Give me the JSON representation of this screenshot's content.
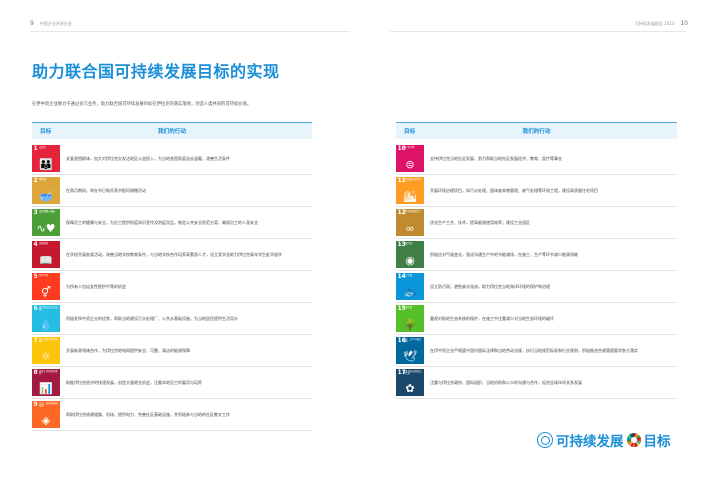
{
  "header": {
    "left_page_number": "9",
    "left_text": "中国企业共享社会",
    "right_text": "可持续发展报告 2023",
    "right_page_number": "10"
  },
  "title": "助力联合国可持续发展目标的实现",
  "intro": "在伊中资企业致力于通过多元业务，助力联合国可持续发展目标在伊拉克的落实落地，创造人类共同的可持续价值。",
  "table_headers": {
    "goal": "目标",
    "action": "我们的行动"
  },
  "left_goals": [
    {
      "num": "1",
      "label": "无贫穷",
      "icon": "family-icon",
      "glyph": "👪",
      "color": "#e5243b",
      "action": "关爱贫困群体，加大对伊拉克欠发达地区公益投入，为当地贫困家庭送去温暖，改善生活条件"
    },
    {
      "num": "2",
      "label": "零饥饿",
      "icon": "bowl-icon",
      "glyph": "🥣",
      "color": "#dda63a",
      "action": "在斋月期间，举办节日和开斋节慰问捐赠活动"
    },
    {
      "num": "3",
      "label": "良好健康与福祉",
      "icon": "heartbeat-icon",
      "glyph": "∿♥",
      "color": "#4c9f38",
      "action": "保障员工的健康与安全，为员工提供防疫知识宣传及防疫用品，制定公共安全防范方案，确保员工的人身安全"
    },
    {
      "num": "4",
      "label": "优质教育",
      "icon": "book-icon",
      "glyph": "📖",
      "color": "#c5192d",
      "action": "在学校开展各类活动，改善当地学校教育条件，与当地学校合作培养高素质人才，设立奖学金助力伊拉克青年学生赴华留学"
    },
    {
      "num": "5",
      "label": "性别平等",
      "icon": "gender-equality-icon",
      "glyph": "⚥",
      "color": "#ff3a21",
      "action": "为所有人包括女性提供平等的机会"
    },
    {
      "num": "6",
      "label": "清洁饮水和卫生设施",
      "icon": "water-icon",
      "glyph": "💧",
      "color": "#26bde2",
      "action": "积极发挥中资企业的优势，帮助当地建设污水处理厂、公共水基础设施，为当地居民提供生活用水"
    },
    {
      "num": "7",
      "label": "经济适用的清洁能源",
      "icon": "energy-icon",
      "glyph": "☼",
      "color": "#fcc30b",
      "action": "开展新源领域合作，为伊拉克地电网提供安全、可靠、清洁的能源保障"
    },
    {
      "num": "8",
      "label": "体面工作和经济增长",
      "icon": "growth-chart-icon",
      "glyph": "📊",
      "color": "#a21942",
      "action": "助推伊拉克经济的快速发展，创造大量就业机会，注重本地员工的雇用与培养"
    },
    {
      "num": "9",
      "label": "产业、创新和基础设施",
      "icon": "infrastructure-icon",
      "glyph": "◈",
      "color": "#fd6925",
      "action": "帮助伊拉克修建道路、机场、提供电力、完善社区基础设施，并积极参与当地的社区教文工作"
    }
  ],
  "right_goals": [
    {
      "num": "10",
      "label": "减少不平等",
      "icon": "reduced-inequality-icon",
      "glyph": "⊜",
      "color": "#dd1367",
      "action": "支持伊拉克当地社区发展，努力帮助当地社区发展经济、教育、医疗等事业"
    },
    {
      "num": "11",
      "label": "可持续城市和社区",
      "icon": "city-icon",
      "glyph": "🏙",
      "color": "#fd9d24",
      "action": "开展环境治理项目，如污水处理、固体废弃物管理、废气处理等环保工程，建设高质量住宅项目"
    },
    {
      "num": "12",
      "label": "负责任消费和生产",
      "icon": "infinity-icon",
      "glyph": "∞",
      "color": "#bf8b2e",
      "action": "优化生产工艺、技术，提高能源使用效率；建设工业园区"
    },
    {
      "num": "13",
      "label": "气候行动",
      "icon": "climate-eye-icon",
      "glyph": "◉",
      "color": "#3f7e44",
      "action": "积极应对气候变化，强化沟通生产中的节能减排，在施工、生产等环节减少能源消耗"
    },
    {
      "num": "14",
      "label": "水下生物",
      "icon": "fish-icon",
      "glyph": "🐟",
      "color": "#0a97d9",
      "action": "设立防污网，避免废水溢流，助力伊拉克当地海洋环境的保护和治理"
    },
    {
      "num": "15",
      "label": "陆地生物",
      "icon": "tree-icon",
      "glyph": "🌳",
      "color": "#56c02b",
      "action": "重视对陆地生态系统的保护，在施工中注重减少对当地生态环境的破坏"
    },
    {
      "num": "16",
      "label": "和平、正义与强大机构",
      "icon": "dove-icon",
      "glyph": "🕊",
      "color": "#00689d",
      "action": "在伊中资企业严格遵守国内国际法律和当地劳动法规，执行当地规范标准和行业规则，积极推进合规管理要求各方落实"
    },
    {
      "num": "17",
      "label": "促进目标实现的伙伴关系",
      "icon": "partnership-icon",
      "glyph": "✿",
      "color": "#19486a",
      "action": "注重与伊拉克政府、国际组织、当地机构和公众的沟通与合作，促进全球伙伴关系发展"
    }
  ],
  "logo": {
    "text": "可持续发展",
    "text2": "目标"
  }
}
